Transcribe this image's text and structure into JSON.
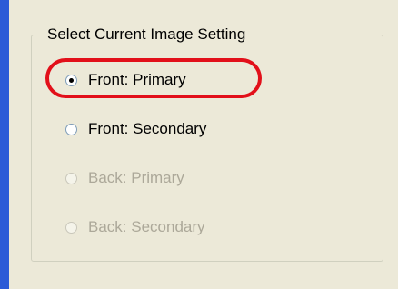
{
  "groupbox": {
    "title": "Select Current Image Setting",
    "options": [
      {
        "label": "Front: Primary",
        "selected": true,
        "enabled": true
      },
      {
        "label": "Front: Secondary",
        "selected": false,
        "enabled": true
      },
      {
        "label": "Back: Primary",
        "selected": false,
        "enabled": false
      },
      {
        "label": "Back: Secondary",
        "selected": false,
        "enabled": false
      }
    ]
  },
  "colors": {
    "accent_bar": "#2b5bd7",
    "highlight": "#e2101a",
    "disabled_text": "#aca899"
  }
}
